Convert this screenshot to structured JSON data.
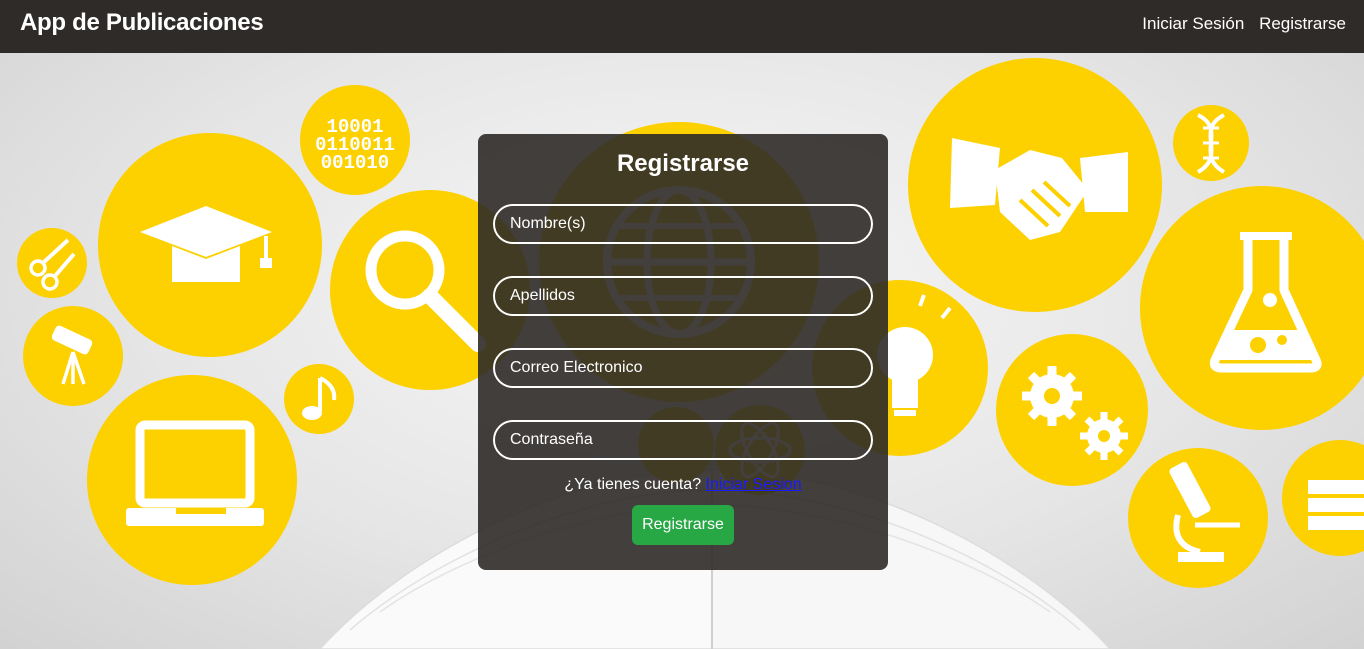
{
  "navbar": {
    "brand": "App de Publicaciones",
    "links": [
      "Iniciar Sesión",
      "Registrarse"
    ]
  },
  "form": {
    "title": "Registrarse",
    "fields": [
      {
        "placeholder": "Nombre(s)",
        "value": ""
      },
      {
        "placeholder": "Apellidos",
        "value": ""
      },
      {
        "placeholder": "Correo Electronico",
        "value": ""
      },
      {
        "placeholder": "Contraseña",
        "value": ""
      }
    ],
    "has_account_text": "¿Ya tienes cuenta?",
    "login_link": "Iniciar Sesion",
    "submit_label": "Registrarse"
  },
  "background": {
    "icons": [
      "graduation-cap-icon",
      "binary-icon",
      "magnifier-icon",
      "scissors-icon",
      "telescope-icon",
      "music-note-icon",
      "laptop-icon",
      "globe-icon",
      "handshake-icon",
      "dna-icon",
      "flask-icon",
      "lightbulb-icon",
      "gears-icon",
      "microscope-icon",
      "books-icon",
      "open-book-icon"
    ],
    "binary_digits": [
      "10001",
      "0110011",
      "001010"
    ]
  },
  "colors": {
    "navbar": "#2e2b29",
    "accent_yellow": "#fdd000",
    "button_green": "#28a745",
    "link_blue": "#1a1aff"
  }
}
